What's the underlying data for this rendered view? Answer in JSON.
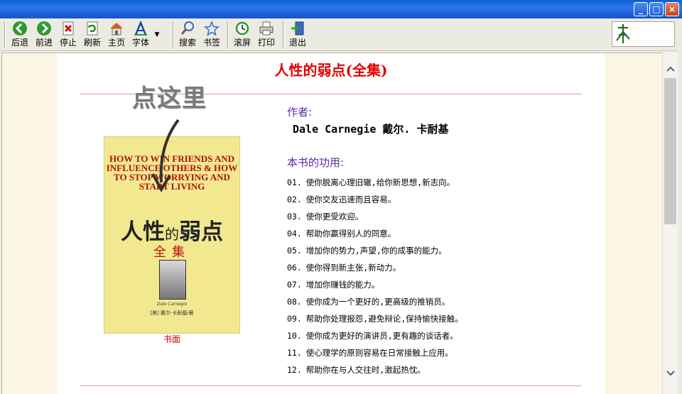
{
  "window": {
    "controls": [
      "_",
      "□",
      "×"
    ]
  },
  "toolbar": {
    "buttons": [
      {
        "label": "后退",
        "icon": "back-arrow-icon"
      },
      {
        "label": "前进",
        "icon": "forward-arrow-icon"
      },
      {
        "label": "停止",
        "icon": "stop-icon"
      },
      {
        "label": "刷新",
        "icon": "refresh-icon"
      },
      {
        "label": "主页",
        "icon": "home-icon"
      },
      {
        "label": "字体",
        "icon": "font-icon"
      },
      {
        "label": "搜索",
        "icon": "search-icon"
      },
      {
        "label": "书签",
        "icon": "bookmark-star-icon"
      },
      {
        "label": "滚屏",
        "icon": "autoscroll-icon"
      },
      {
        "label": "打印",
        "icon": "printer-icon"
      },
      {
        "label": "退出",
        "icon": "exit-icon"
      }
    ],
    "dropdown_glyph": "▼"
  },
  "content": {
    "title": "人性的弱点(全集)",
    "hint": "点这里",
    "cover": {
      "english_title": "HOW TO WIN FRIENDS AND INFLUENCE OTHERS & HOW TO STOP WORRYING AND START LIVING",
      "chinese_title_1": "人性",
      "chinese_title_2": "的",
      "chinese_title_3": "弱点",
      "chinese_subtitle": "全集",
      "signature": "Dale Carnegie",
      "author_line": "[美] 戴尔·卡耐基/著",
      "caption": "书面"
    },
    "author_label": "作者:",
    "author_name": "Dale Carnegie 戴尔. 卡耐基",
    "benefits_label": "本书的功用:",
    "benefits": [
      {
        "num": "01.",
        "text": "使你脱离心理旧辙,给你新思想,新志向。"
      },
      {
        "num": "02.",
        "text": "使你交友迅速而且容易。"
      },
      {
        "num": "03.",
        "text": "使你更受欢迎。"
      },
      {
        "num": "04.",
        "text": "帮助你赢得别人的同意。"
      },
      {
        "num": "05.",
        "text": "增加你的势力,声望,你的成事的能力。"
      },
      {
        "num": "06.",
        "text": "使你得到新主张,新动力。"
      },
      {
        "num": "07.",
        "text": "增加你赚钱的能力。"
      },
      {
        "num": "08.",
        "text": "使你成为一个更好的,更高级的推销员。"
      },
      {
        "num": "09.",
        "text": "帮助你处理报怨,避免辩论,保持愉快接触。"
      },
      {
        "num": "10.",
        "text": "使你成为更好的演讲员,更有趣的谈话者。"
      },
      {
        "num": "11.",
        "text": "使心理学的原则容易在日常接触上应用。"
      },
      {
        "num": "12.",
        "text": "帮助你在与人交往时,激起热忱。"
      }
    ]
  },
  "colors": {
    "title_red": "#e30000",
    "label_purple": "#5a2ab0",
    "page_bg": "#fcf7e4",
    "titlebar_blue": "#1553cc"
  }
}
